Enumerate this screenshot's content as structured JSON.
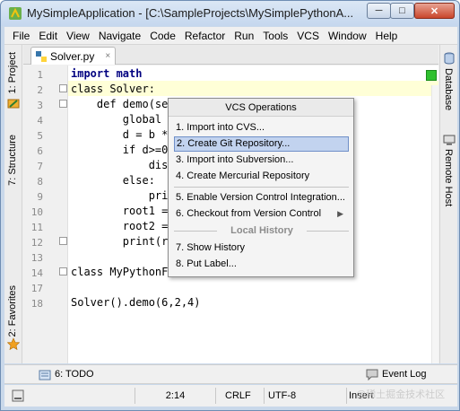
{
  "window": {
    "title": "MySimpleApplication - [C:\\SampleProjects\\MySimplePythonA...",
    "min_label": "─",
    "max_label": "□",
    "close_label": "✕"
  },
  "menu": [
    "File",
    "Edit",
    "View",
    "Navigate",
    "Code",
    "Refactor",
    "Run",
    "Tools",
    "VCS",
    "Window",
    "Help"
  ],
  "left_tabs": {
    "project": "1: Project",
    "structure": "7: Structure",
    "favorites": "2: Favorites"
  },
  "right_tabs": {
    "database": "Database",
    "remote_host": "Remote Host"
  },
  "editor": {
    "tab_label": "Solver.py",
    "lines": [
      {
        "num": "1",
        "code": "import math"
      },
      {
        "num": "2",
        "code": "class Solver:"
      },
      {
        "num": "3",
        "code": "    def demo(sel"
      },
      {
        "num": "4",
        "code": "        global d"
      },
      {
        "num": "5",
        "code": "        d = b *"
      },
      {
        "num": "6",
        "code": "        if d>=0"
      },
      {
        "num": "7",
        "code": "            disc"
      },
      {
        "num": "8",
        "code": "        else:"
      },
      {
        "num": "9",
        "code": "            prin"
      },
      {
        "num": "10",
        "code": "        root1 ="
      },
      {
        "num": "11",
        "code": "        root2 ="
      },
      {
        "num": "12",
        "code": "        print(ro"
      },
      {
        "num": "13",
        "code": ""
      },
      {
        "num": "14",
        "code": "class MyPythonF..."
      },
      {
        "num": "17",
        "code": ""
      },
      {
        "num": "18",
        "code": "Solver().demo(6,2,4)"
      }
    ]
  },
  "popup": {
    "title": "VCS Operations",
    "items": [
      "1. Import into CVS...",
      "2. Create Git Repository...",
      "3. Import into Subversion...",
      "4. Create Mercurial Repository",
      "5. Enable Version Control Integration...",
      "6. Checkout from Version Control",
      "7. Show History",
      "8. Put Label..."
    ],
    "section": "Local History"
  },
  "bottom": {
    "todo": "6: TODO",
    "event_log": "Event Log"
  },
  "status": {
    "position": "2:14",
    "line_sep": "CRLF",
    "encoding": "UTF-8",
    "mode": "Insert"
  },
  "watermark": "@稀土掘金技术社区",
  "colors": {
    "accent": "#c2d3ef",
    "highlight_line": "#ffffd7",
    "status_ok": "#2fc02f"
  }
}
